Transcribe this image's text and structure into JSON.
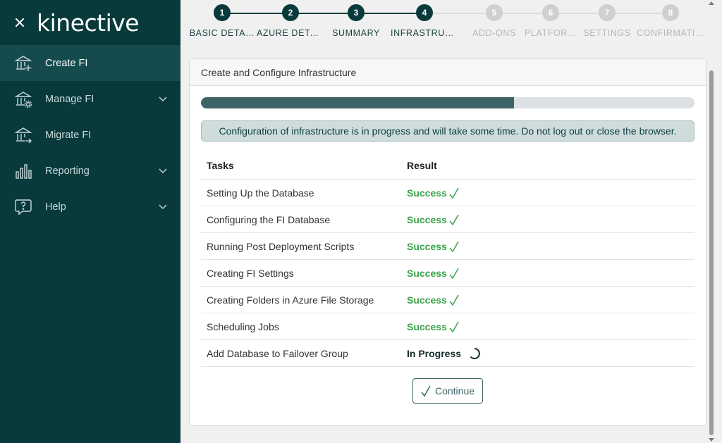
{
  "app": {
    "brand": "kinective"
  },
  "sidebar": {
    "items": [
      {
        "label": "Create FI",
        "icon": "bank-plus-icon",
        "active": true,
        "expandable": false
      },
      {
        "label": "Manage FI",
        "icon": "bank-gear-icon",
        "active": false,
        "expandable": true
      },
      {
        "label": "Migrate FI",
        "icon": "bank-arrow-icon",
        "active": false,
        "expandable": false
      },
      {
        "label": "Reporting",
        "icon": "bar-chart-icon",
        "active": false,
        "expandable": true
      },
      {
        "label": "Help",
        "icon": "help-bubble-icon",
        "active": false,
        "expandable": true
      }
    ]
  },
  "stepper": {
    "steps": [
      {
        "number": "1",
        "label": "BASIC DETA…",
        "status": "complete"
      },
      {
        "number": "2",
        "label": "AZURE DETA…",
        "status": "complete"
      },
      {
        "number": "3",
        "label": "SUMMARY",
        "status": "complete"
      },
      {
        "number": "4",
        "label": "INFRASTRUCT…",
        "status": "current"
      },
      {
        "number": "5",
        "label": "ADD-ONS",
        "status": "pending"
      },
      {
        "number": "6",
        "label": "PLATFOR…",
        "status": "pending"
      },
      {
        "number": "7",
        "label": "SETTINGS",
        "status": "pending"
      },
      {
        "number": "8",
        "label": "CONFIRMATI…",
        "status": "pending"
      }
    ]
  },
  "card": {
    "title": "Create and Configure Infrastructure",
    "progress_fraction": 0.634,
    "alert": "Configuration of infrastructure is in progress and will take some time. Do not log out or close the browser.",
    "table": {
      "headers": {
        "task": "Tasks",
        "result": "Result"
      },
      "rows": [
        {
          "task": "Setting Up the Database",
          "result": "Success",
          "status": "success"
        },
        {
          "task": "Configuring the FI Database",
          "result": "Success",
          "status": "success"
        },
        {
          "task": "Running Post Deployment Scripts",
          "result": "Success",
          "status": "success"
        },
        {
          "task": "Creating FI Settings",
          "result": "Success",
          "status": "success"
        },
        {
          "task": "Creating Folders in Azure File Storage",
          "result": "Success",
          "status": "success"
        },
        {
          "task": "Scheduling Jobs",
          "result": "Success",
          "status": "success"
        },
        {
          "task": "Add Database to Failover Group",
          "result": "In Progress",
          "status": "in-progress"
        }
      ]
    },
    "continue_label": "Continue"
  },
  "colors": {
    "sidebar_bg": "#083a3c",
    "accent": "#3d6466",
    "success": "#3aa34b"
  }
}
